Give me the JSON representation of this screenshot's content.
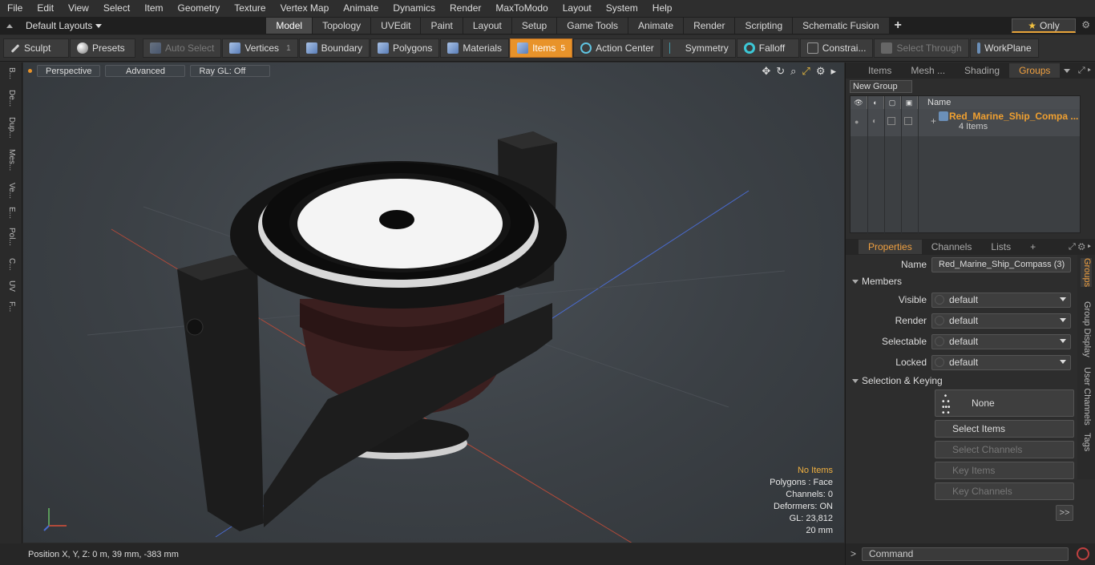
{
  "menu": [
    "File",
    "Edit",
    "View",
    "Select",
    "Item",
    "Geometry",
    "Texture",
    "Vertex Map",
    "Animate",
    "Dynamics",
    "Render",
    "MaxToModo",
    "Layout",
    "System",
    "Help"
  ],
  "layouts": {
    "selector": "Default Layouts",
    "tabs": [
      "Model",
      "Topology",
      "UVEdit",
      "Paint",
      "Layout",
      "Setup",
      "Game Tools",
      "Animate",
      "Render",
      "Scripting",
      "Schematic Fusion"
    ],
    "active": "Model",
    "only": "Only"
  },
  "toolbar": {
    "sculpt": "Sculpt",
    "presets": "Presets",
    "auto_select": "Auto Select",
    "vertices": "Vertices",
    "vertices_count": "1",
    "boundary": "Boundary",
    "polygons": "Polygons",
    "materials": "Materials",
    "items": "Items",
    "items_count": "5",
    "action_center": "Action Center",
    "symmetry": "Symmetry",
    "falloff": "Falloff",
    "constraints": "Constrai...",
    "select_through": "Select Through",
    "workplane": "WorkPlane"
  },
  "left_tabs": [
    "B...",
    "De...",
    "Dup...",
    "Mes...",
    "Ve...",
    "E...",
    "Pol...",
    "C...",
    "UV",
    "F..."
  ],
  "viewport": {
    "perspective": "Perspective",
    "advanced": "Advanced",
    "raygl": "Ray GL: Off"
  },
  "stats": {
    "items": "No Items",
    "polygons": "Polygons : Face",
    "channels": "Channels: 0",
    "deformers": "Deformers: ON",
    "gl": "GL: 23,812",
    "scale": "20 mm"
  },
  "status": {
    "position": "Position X, Y, Z:   0 m, 39 mm, -383 mm"
  },
  "rpanel": {
    "tabs": [
      "Items",
      "Mesh ...",
      "Shading",
      "Groups"
    ],
    "active_tab": "Groups",
    "new_group": "New Group",
    "col_name": "Name",
    "group_name": "Red_Marine_Ship_Compa ...",
    "group_count": "4 Items"
  },
  "props": {
    "tabs": [
      "Properties",
      "Channels",
      "Lists"
    ],
    "name_label": "Name",
    "name_value": "Red_Marine_Ship_Compass (3)",
    "members": "Members",
    "visible_label": "Visible",
    "visible": "default",
    "render_label": "Render",
    "render": "default",
    "selectable_label": "Selectable",
    "selectable": "default",
    "locked_label": "Locked",
    "locked": "default",
    "sel_keying": "Selection & Keying",
    "none": "None",
    "select_items": "Select Items",
    "select_channels": "Select Channels",
    "key_items": "Key Items",
    "key_channels": "Key Channels",
    "more": ">>",
    "side_tabs": [
      "Groups",
      "Group Display",
      "User Channels",
      "Tags"
    ]
  },
  "command": {
    "placeholder": "Command"
  }
}
